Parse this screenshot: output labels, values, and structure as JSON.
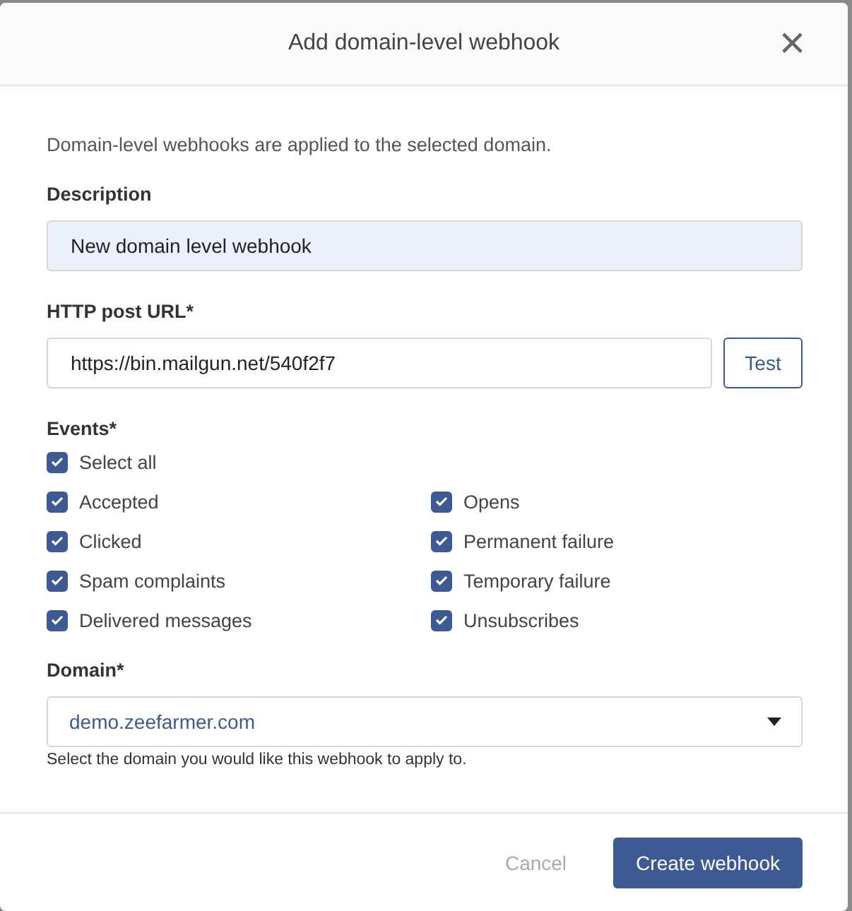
{
  "dialog": {
    "title": "Add domain-level webhook",
    "close": "×"
  },
  "intro": "Domain-level webhooks are applied to the selected domain.",
  "description": {
    "label": "Description",
    "value": "New domain level webhook"
  },
  "url": {
    "label": "HTTP post URL*",
    "value": "https://bin.mailgun.net/540f2f7",
    "test_button": "Test"
  },
  "events": {
    "label": "Events*",
    "select_all": {
      "label": "Select all",
      "checked": true
    },
    "columns": [
      [
        {
          "label": "Accepted",
          "checked": true
        },
        {
          "label": "Clicked",
          "checked": true
        },
        {
          "label": "Spam complaints",
          "checked": true
        },
        {
          "label": "Delivered messages",
          "checked": true
        }
      ],
      [
        {
          "label": "Opens",
          "checked": true
        },
        {
          "label": "Permanent failure",
          "checked": true
        },
        {
          "label": "Temporary failure",
          "checked": true
        },
        {
          "label": "Unsubscribes",
          "checked": true
        }
      ]
    ]
  },
  "domain": {
    "label": "Domain*",
    "value": "demo.zeefarmer.com",
    "help": "Select the domain you would like this webhook to apply to."
  },
  "footer": {
    "cancel": {
      "label": "Cancel",
      "disabled": true
    },
    "submit": "Create webhook"
  }
}
